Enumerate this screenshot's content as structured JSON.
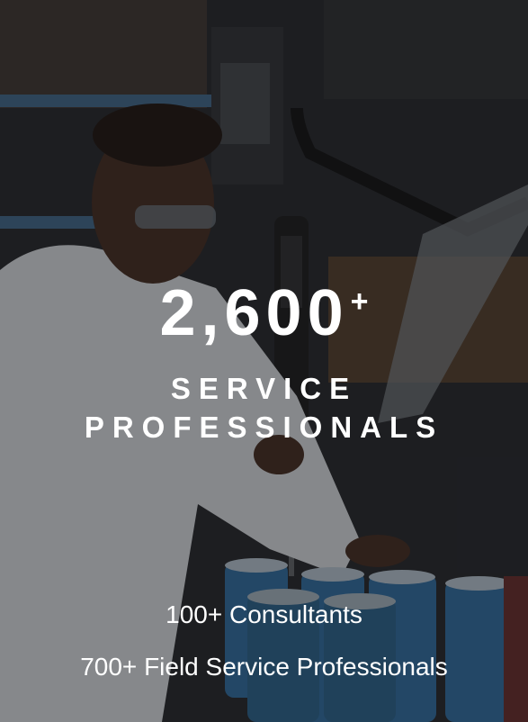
{
  "colors": {
    "overlay": "#0a0a0c",
    "text": "#ffffff"
  },
  "hero": {
    "number": "2,600",
    "suffix": "+",
    "subtitle_line1": "SERVICE",
    "subtitle_line2": "PROFESSIONALS"
  },
  "stats": [
    {
      "label": "100+ Consultants"
    },
    {
      "label": "700+ Field Service Professionals"
    }
  ]
}
